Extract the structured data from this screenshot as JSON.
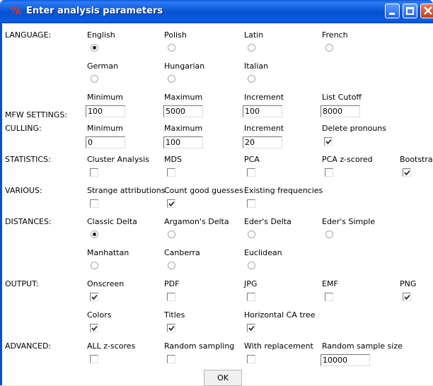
{
  "window": {
    "title": "Enter analysis parameters",
    "icon": "tk-feather-icon"
  },
  "sections": {
    "language": "LANGUAGE:",
    "mfw": "MFW SETTINGS:",
    "culling": "CULLING:",
    "statistics": "STATISTICS:",
    "various": "VARIOUS:",
    "distances": "DISTANCES:",
    "output": "OUTPUT:",
    "advanced": "ADVANCED:"
  },
  "language": {
    "options": [
      "English",
      "Polish",
      "Latin",
      "French",
      "German",
      "Hungarian",
      "Italian"
    ],
    "selected": "English"
  },
  "mfw": {
    "labels": [
      "Minimum",
      "Maximum",
      "Increment",
      "List Cutoff"
    ],
    "values": [
      "100",
      "5000",
      "100",
      "8000"
    ]
  },
  "culling": {
    "labels": [
      "Minimum",
      "Maximum",
      "Increment",
      "Delete pronouns"
    ],
    "values": [
      "0",
      "100",
      "20"
    ],
    "delete_pronouns": true
  },
  "statistics": {
    "labels": [
      "Cluster Analysis",
      "MDS",
      "PCA",
      "PCA z-scored",
      "Bootstrap"
    ],
    "checked": [
      false,
      false,
      false,
      false,
      true
    ]
  },
  "various": {
    "labels": [
      "Strange attributions",
      "Count good guesses",
      "Existing frequencies"
    ],
    "checked": [
      false,
      true,
      false
    ]
  },
  "distances": {
    "options": [
      "Classic Delta",
      "Argamon's Delta",
      "Eder's Delta",
      "Eder's Simple",
      "Manhattan",
      "Canberra",
      "Euclidean"
    ],
    "selected": "Classic Delta"
  },
  "output": {
    "labels": [
      "Onscreen",
      "PDF",
      "JPG",
      "EMF",
      "PNG",
      "Colors",
      "Titles",
      "Horizontal CA tree"
    ],
    "checked": [
      true,
      false,
      false,
      false,
      true,
      true,
      true,
      true
    ]
  },
  "advanced": {
    "labels": [
      "ALL z-scores",
      "Random sampling",
      "With replacement",
      "Random sample size"
    ],
    "checked": [
      false,
      false,
      false
    ],
    "sample_size": "10000"
  },
  "ok_label": "OK"
}
